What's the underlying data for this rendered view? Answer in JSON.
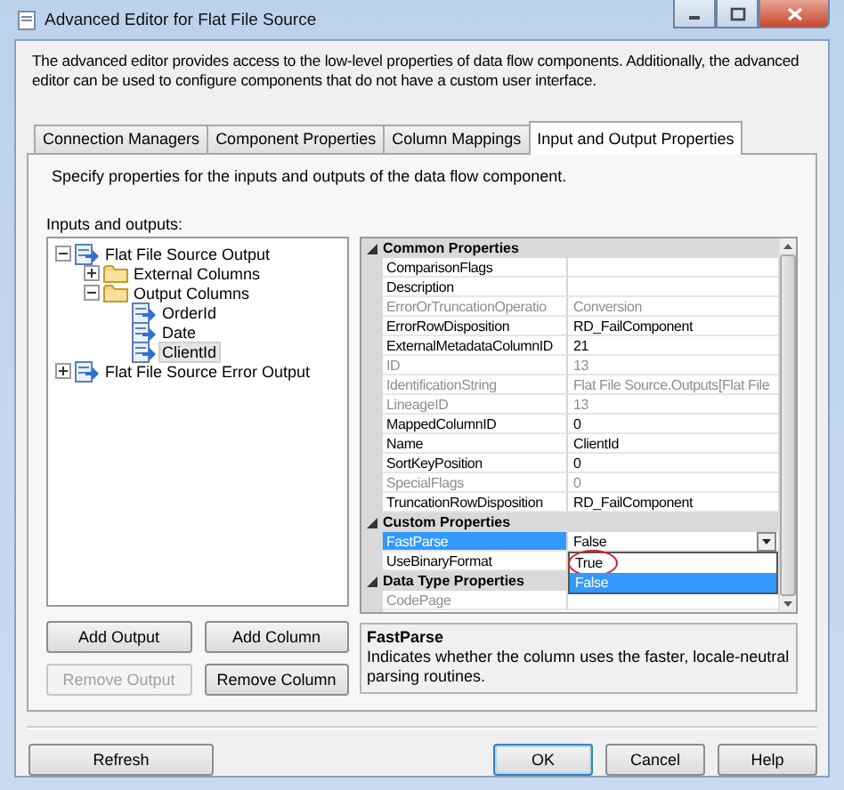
{
  "window": {
    "title": "Advanced Editor for Flat File Source"
  },
  "intro": "The advanced editor provides access to the low-level properties of data flow components. Additionally, the advanced editor can be used to configure components that do not have a custom user interface.",
  "tabs": [
    {
      "label": "Connection Managers",
      "selected": false
    },
    {
      "label": "Component Properties",
      "selected": false
    },
    {
      "label": "Column Mappings",
      "selected": false
    },
    {
      "label": "Input and Output Properties",
      "selected": true
    }
  ],
  "panel": {
    "instructions": "Specify properties for the inputs and outputs of the data flow component.",
    "tree_label": "Inputs and outputs:",
    "tree": [
      {
        "label": "Flat File Source Output",
        "kind": "output",
        "expanded": true,
        "selected": false,
        "children": [
          {
            "label": "External Columns",
            "kind": "folder",
            "expanded": false,
            "selected": false
          },
          {
            "label": "Output Columns",
            "kind": "folder",
            "expanded": true,
            "selected": false,
            "children": [
              {
                "label": "OrderId",
                "kind": "column",
                "selected": false
              },
              {
                "label": "Date",
                "kind": "column",
                "selected": false
              },
              {
                "label": "ClientId",
                "kind": "column",
                "selected": true
              }
            ]
          }
        ]
      },
      {
        "label": "Flat File Source Error Output",
        "kind": "output",
        "expanded": false,
        "selected": false
      }
    ],
    "buttons": [
      {
        "label": "Add Output",
        "disabled": false
      },
      {
        "label": "Add Column",
        "disabled": false
      },
      {
        "label": "Remove Output",
        "disabled": true
      },
      {
        "label": "Remove Column",
        "disabled": false
      }
    ],
    "properties": {
      "groups": [
        {
          "name": "Common Properties",
          "expanded": true,
          "rows": [
            {
              "name": "ComparisonFlags",
              "value": "",
              "readonly": false,
              "selected": false
            },
            {
              "name": "Description",
              "readonly": false,
              "selected": false
            },
            {
              "name": "ErrorOrTruncationOperatio",
              "value": "Conversion",
              "readonly": true,
              "selected": false
            },
            {
              "name": "ErrorRowDisposition",
              "value": "RD_FailComponent",
              "readonly": false,
              "selected": false
            },
            {
              "name": "ExternalMetadataColumnID",
              "value": "21",
              "readonly": false,
              "selected": false
            },
            {
              "name": "ID",
              "value": "13",
              "readonly": true,
              "selected": false
            },
            {
              "name": "IdentificationString",
              "value": "Flat File Source.Outputs[Flat File",
              "readonly": true,
              "selected": false
            },
            {
              "name": "LineageID",
              "value": "13",
              "readonly": true,
              "selected": false
            },
            {
              "name": "MappedColumnID",
              "value": "0",
              "readonly": false,
              "selected": false
            },
            {
              "name": "Name",
              "value": "ClientId",
              "readonly": false,
              "selected": false
            },
            {
              "name": "SortKeyPosition",
              "value": "0",
              "readonly": false,
              "selected": false
            },
            {
              "name": "SpecialFlags",
              "value": "0",
              "readonly": true,
              "selected": false
            },
            {
              "name": "TruncationRowDisposition",
              "value": "RD_FailComponent",
              "readonly": false,
              "selected": false
            }
          ]
        },
        {
          "name": "Custom Properties",
          "expanded": true,
          "rows": [
            {
              "name": "FastParse",
              "value": "False",
              "readonly": false,
              "selected": true,
              "dropdown": {
                "options": [
                  {
                    "label": "True",
                    "selected": false,
                    "circled": true
                  },
                  {
                    "label": "False",
                    "selected": true,
                    "circled": false
                  }
                ]
              }
            },
            {
              "name": "UseBinaryFormat",
              "readonly": false,
              "selected": false
            }
          ]
        },
        {
          "name": "Data Type Properties",
          "expanded": true,
          "rows": [
            {
              "name": "CodePage",
              "readonly": true,
              "selected": false
            }
          ]
        }
      ]
    },
    "description": {
      "title": "FastParse",
      "text": "Indicates whether the column uses the faster, locale-neutral parsing routines."
    }
  },
  "footer_buttons": [
    {
      "label": "Refresh",
      "default": false
    },
    {
      "label": "OK",
      "default": true
    },
    {
      "label": "Cancel",
      "default": false
    },
    {
      "label": "Help",
      "default": false
    }
  ]
}
